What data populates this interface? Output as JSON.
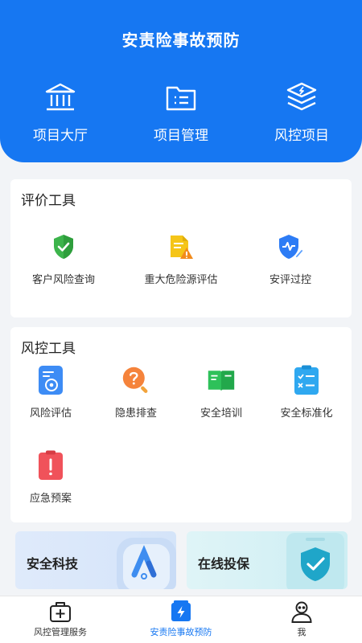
{
  "header": {
    "title": "安责险事故预防",
    "nav": [
      {
        "label": "项目大厅",
        "icon": "hall-icon"
      },
      {
        "label": "项目管理",
        "icon": "folder-list-icon"
      },
      {
        "label": "风控项目",
        "icon": "layers-icon"
      }
    ]
  },
  "evaluation_tools": {
    "title": "评价工具",
    "items": [
      {
        "label": "客户风险查询",
        "icon": "shield-check-icon"
      },
      {
        "label": "重大危险源评估",
        "icon": "document-warning-icon"
      },
      {
        "label": "安评过控",
        "icon": "shield-pulse-icon"
      }
    ]
  },
  "risk_tools": {
    "title": "风控工具",
    "items": [
      {
        "label": "风险评估",
        "icon": "risk-assessment-icon"
      },
      {
        "label": "隐患排查",
        "icon": "question-search-icon"
      },
      {
        "label": "安全培训",
        "icon": "book-icon"
      },
      {
        "label": "安全标准化",
        "icon": "checklist-icon"
      },
      {
        "label": "应急预案",
        "icon": "clipboard-alert-icon"
      }
    ]
  },
  "banners": [
    {
      "label": "安全科技",
      "icon": "tech-logo-icon"
    },
    {
      "label": "在线投保",
      "icon": "shield-check-icon"
    }
  ],
  "tabbar": {
    "items": [
      {
        "label": "风控管理服务",
        "icon": "medkit-icon",
        "active": false
      },
      {
        "label": "安责险事故预防",
        "icon": "battery-bolt-icon",
        "active": true
      },
      {
        "label": "我",
        "icon": "user-icon",
        "active": false
      }
    ]
  },
  "colors": {
    "primary": "#1677f2",
    "background": "#f2f4f7"
  }
}
